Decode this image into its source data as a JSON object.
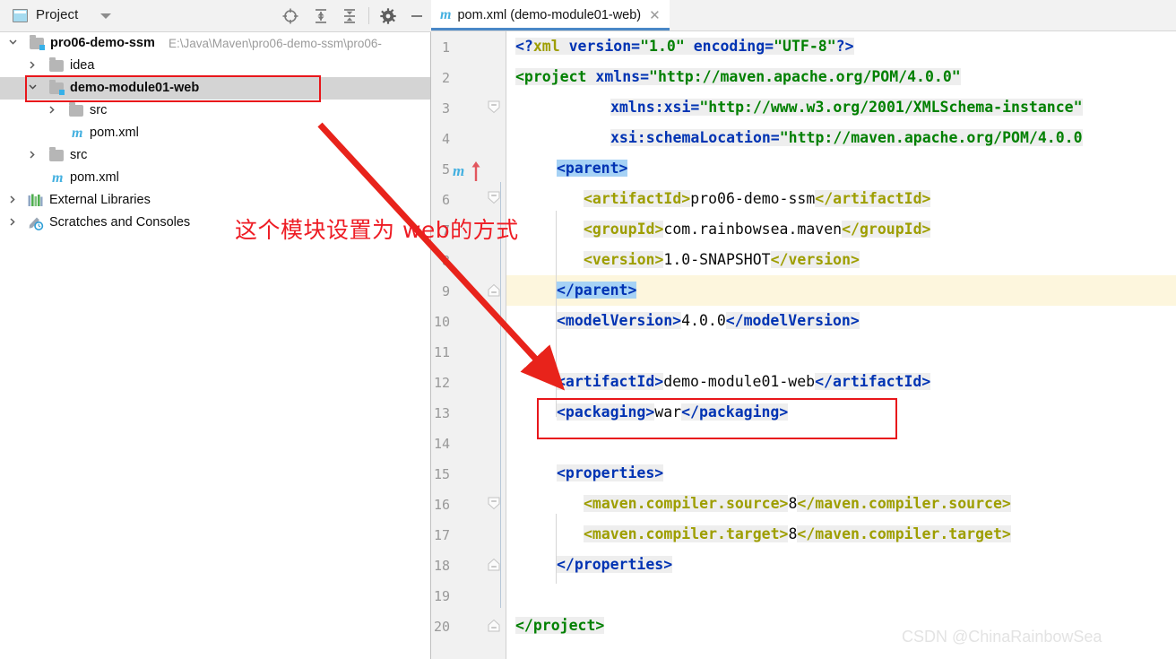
{
  "project_panel": {
    "title": "Project",
    "icon": "project-view-icon",
    "dropdown_icon": "chevron-down-icon",
    "toolbar_buttons": [
      {
        "name": "locate-icon",
        "label": "Select Opened File"
      },
      {
        "name": "expand-all-icon",
        "label": "Expand All"
      },
      {
        "name": "collapse-all-icon",
        "label": "Collapse All"
      },
      {
        "name": "gear-icon",
        "label": "Settings"
      },
      {
        "name": "minimize-icon",
        "label": "Hide"
      }
    ],
    "tree": [
      {
        "label": "pro06-demo-ssm",
        "path": "E:\\Java\\Maven\\pro06-demo-ssm\\pro06-",
        "indent": 0,
        "arrow": "down",
        "icon": "module-folder-icon",
        "bold": true,
        "selected": false
      },
      {
        "label": "idea",
        "path": "",
        "indent": 1,
        "arrow": "right",
        "icon": "folder-icon",
        "bold": false,
        "selected": false
      },
      {
        "label": "demo-module01-web",
        "path": "",
        "indent": 1,
        "arrow": "down",
        "icon": "module-folder-icon",
        "bold": true,
        "selected": true
      },
      {
        "label": "src",
        "path": "",
        "indent": 2,
        "arrow": "right",
        "icon": "folder-icon",
        "bold": false,
        "selected": false
      },
      {
        "label": "pom.xml",
        "path": "",
        "indent": 2,
        "arrow": "none",
        "icon": "maven-file-icon",
        "bold": false,
        "selected": false
      },
      {
        "label": "src",
        "path": "",
        "indent": 1,
        "arrow": "right",
        "icon": "folder-icon",
        "bold": false,
        "selected": false
      },
      {
        "label": "pom.xml",
        "path": "",
        "indent": 1,
        "arrow": "none",
        "icon": "maven-file-icon",
        "bold": false,
        "selected": false
      },
      {
        "label": "External Libraries",
        "path": "",
        "indent": 0,
        "arrow": "right",
        "icon": "libraries-icon",
        "bold": false,
        "selected": false
      },
      {
        "label": "Scratches and Consoles",
        "path": "",
        "indent": 0,
        "arrow": "right",
        "icon": "scratches-icon",
        "bold": false,
        "selected": false
      }
    ]
  },
  "editor": {
    "tab": {
      "icon": "maven-file-icon",
      "label": "pom.xml (demo-module01-web)",
      "close_icon": "close-icon",
      "active": true
    },
    "line_numbers": [
      "1",
      "2",
      "3",
      "4",
      "5",
      "6",
      "7",
      "8",
      "9",
      "10",
      "11",
      "12",
      "13",
      "14",
      "15",
      "16",
      "17",
      "18",
      "19",
      "20"
    ],
    "current_line": 9,
    "gutter_marker": {
      "line": 5,
      "icon": "maven-parent-icon",
      "arrow_icon": "navigate-up-arrow-icon"
    },
    "lines": {
      "l1_open": "<?",
      "l1_xml": "xml",
      "l1_attr1": " version=",
      "l1_val1": "\"1.0\"",
      "l1_attr2": " encoding=",
      "l1_val2": "\"UTF-8\"",
      "l1_close": "?>",
      "l2_a": "<project",
      "l2_b": " xmlns=",
      "l2_c": "\"http://maven.apache.org/POM/4.0.0\"",
      "l3_a": "xmlns:xsi=",
      "l3_b": "\"http://www.w3.org/2001/XMLSchema-instance\"",
      "l4_a": "xsi:schemaLocation=",
      "l4_b": "\"http://maven.apache.org/POM/4.0.0",
      "l5": "<parent>",
      "l6_o": "<artifactId>",
      "l6_v": "pro06-demo-ssm",
      "l6_c": "</artifactId>",
      "l7_o": "<groupId>",
      "l7_v": "com.rainbowsea.maven",
      "l7_c": "</groupId>",
      "l8_o": "<version>",
      "l8_v": "1.0-SNAPSHOT",
      "l8_c": "</version>",
      "l9": "</parent>",
      "l10_o": "<modelVersion>",
      "l10_v": "4.0.0",
      "l10_c": "</modelVersion>",
      "l12_o": "<artifactId>",
      "l12_v": "demo-module01-web",
      "l12_c": "</artifactId>",
      "l13_o": "<packaging>",
      "l13_v": "war",
      "l13_c": "</packaging>",
      "l15": "<properties>",
      "l16_o": "<maven.compiler.source>",
      "l16_v": "8",
      "l16_c": "</maven.compiler.source>",
      "l17_o": "<maven.compiler.target>",
      "l17_v": "8",
      "l17_c": "</maven.compiler.target>",
      "l18": "</properties>",
      "l20": "</project>"
    }
  },
  "annotations": {
    "note_text": "这个模块设置为 web的方式",
    "note_color": "#ee1c24",
    "rect_color": "#e8161b",
    "arrow_color": "#e8231b",
    "highlight_module_rect": "demo-module01-web",
    "highlight_packaging_rect": "<packaging>war</packaging>"
  },
  "watermark": {
    "text": "CSDN @ChinaRainbowSea"
  }
}
